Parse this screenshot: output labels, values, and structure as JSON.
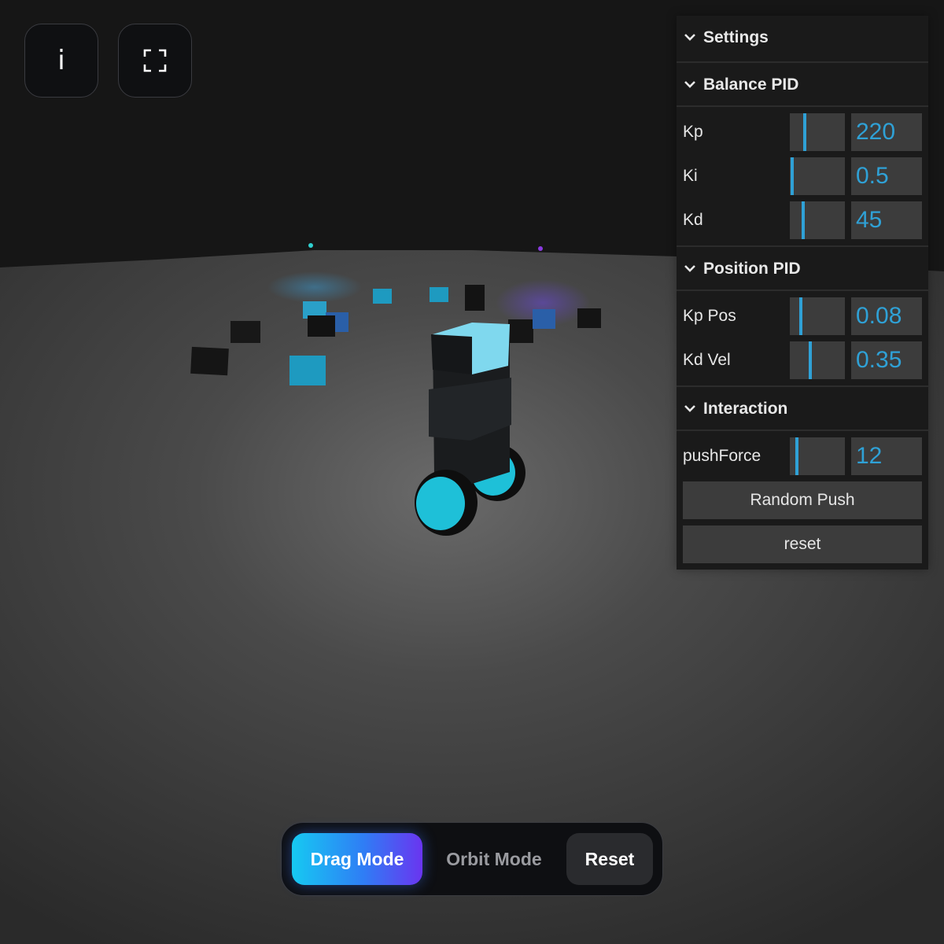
{
  "top_buttons": {
    "info_label": "i"
  },
  "settings": {
    "title": "Settings",
    "folders": {
      "balance": {
        "title": "Balance PID",
        "rows": [
          {
            "label": "Kp",
            "value": "220"
          },
          {
            "label": "Ki",
            "value": "0.5"
          },
          {
            "label": "Kd",
            "value": "45"
          }
        ]
      },
      "position": {
        "title": "Position PID",
        "rows": [
          {
            "label": "Kp Pos",
            "value": "0.08"
          },
          {
            "label": "Kd Vel",
            "value": "0.35"
          }
        ]
      },
      "interaction": {
        "title": "Interaction",
        "rows": [
          {
            "label": "pushForce",
            "value": "12"
          }
        ],
        "random_push_label": "Random Push",
        "reset_label": "reset"
      }
    }
  },
  "toolbar": {
    "drag_label": "Drag Mode",
    "orbit_label": "Orbit Mode",
    "reset_label": "Reset"
  },
  "colors": {
    "accent": "#2fa1d6",
    "robot_cyan": "#1ec0d8",
    "drag_gradient_start": "#16c9f2",
    "drag_gradient_end": "#6a35f0"
  }
}
